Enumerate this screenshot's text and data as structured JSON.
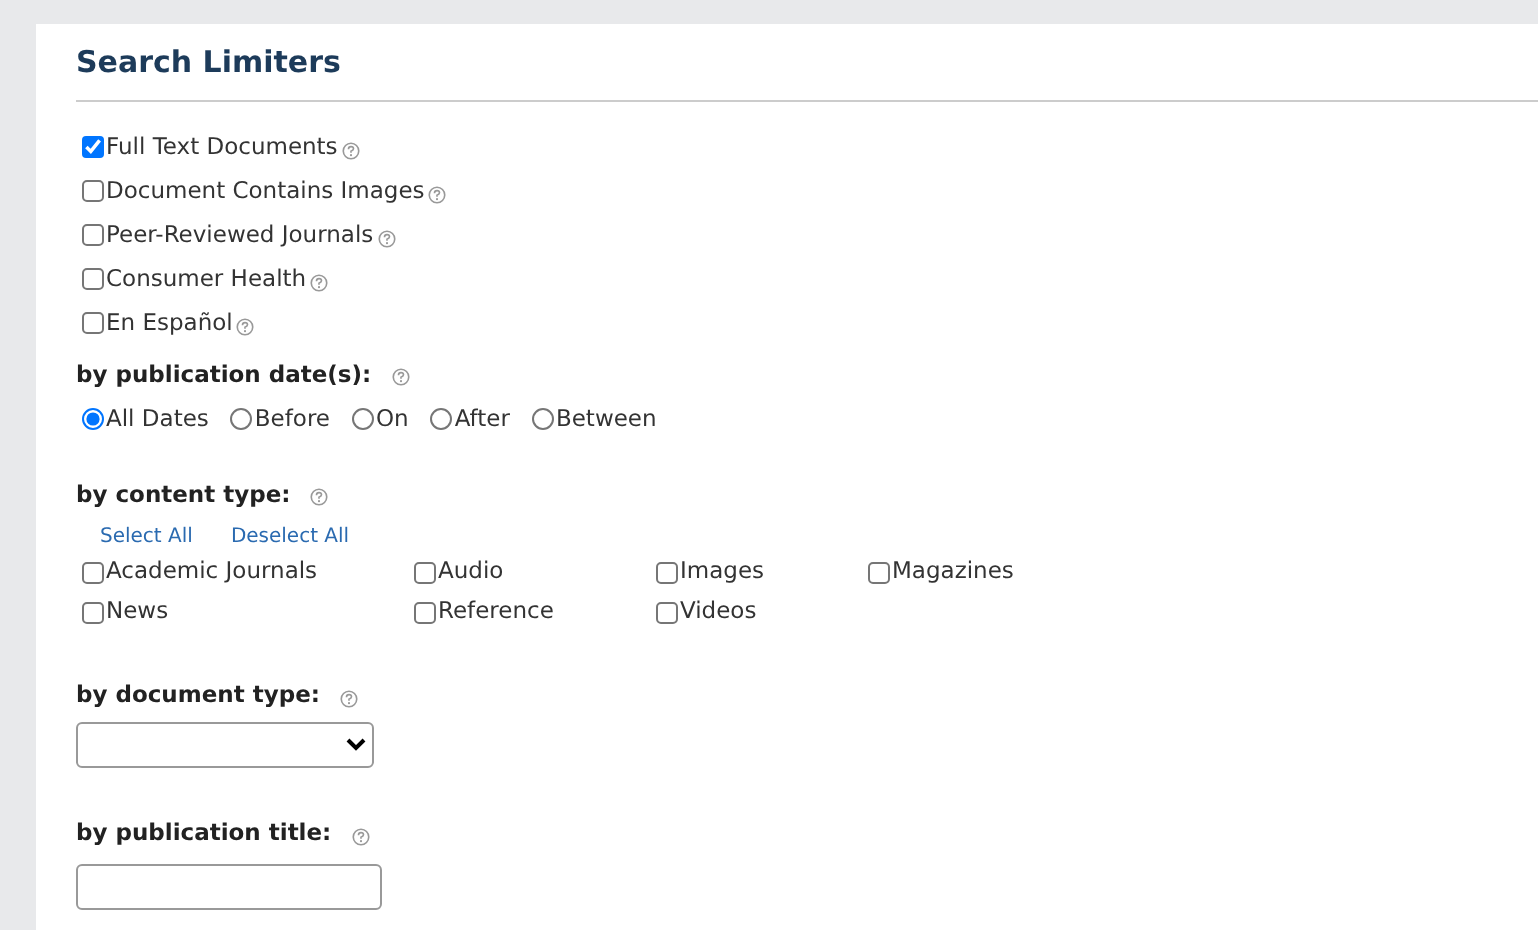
{
  "title": "Search Limiters",
  "limiters": [
    {
      "label": "Full Text Documents",
      "checked": true
    },
    {
      "label": "Document Contains Images",
      "checked": false
    },
    {
      "label": "Peer-Reviewed Journals",
      "checked": false
    },
    {
      "label": "Consumer Health",
      "checked": false
    },
    {
      "label": "En Español",
      "checked": false
    }
  ],
  "publication_date": {
    "label": "by publication date(s):",
    "options": [
      {
        "label": "All Dates",
        "selected": true
      },
      {
        "label": "Before",
        "selected": false
      },
      {
        "label": "On",
        "selected": false
      },
      {
        "label": "After",
        "selected": false
      },
      {
        "label": "Between",
        "selected": false
      }
    ]
  },
  "content_type": {
    "label": "by content type:",
    "links": [
      "Select All",
      "Deselect All"
    ],
    "options": [
      {
        "label": "Academic Journals",
        "checked": false
      },
      {
        "label": "Audio",
        "checked": false
      },
      {
        "label": "Images",
        "checked": false
      },
      {
        "label": "Magazines",
        "checked": false
      },
      {
        "label": "News",
        "checked": false
      },
      {
        "label": "Reference",
        "checked": false
      },
      {
        "label": "Videos",
        "checked": false
      }
    ]
  },
  "document_type": {
    "label": "by document type:"
  },
  "publication_title": {
    "label": "by publication title:"
  }
}
